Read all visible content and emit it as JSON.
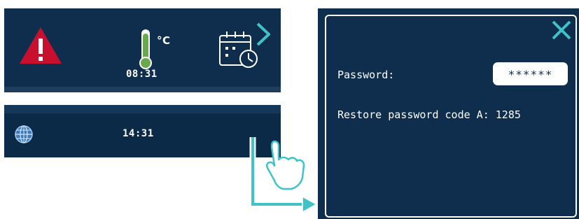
{
  "status_top": {
    "temperature_unit": "°C",
    "time": "08:31",
    "icons": {
      "alarm": "warning-triangle-icon",
      "thermometer": "thermometer-icon",
      "calendar": "calendar-clock-icon"
    },
    "colors": {
      "background": "#0f2d4d",
      "alarm": "#c8102e",
      "thermometer": "#6aa84f"
    }
  },
  "status_bottom": {
    "time": "14:31",
    "icons": {
      "globe": "globe-icon",
      "next": "chevron-right-icon"
    }
  },
  "dialog": {
    "password_label": "Password:",
    "password_value": "******",
    "restore_text": "Restore password code A: 1285",
    "icons": {
      "close": "close-icon"
    },
    "colors": {
      "background": "#0f2d4d",
      "accent": "#3fc3c9"
    }
  },
  "annotation": {
    "icons": {
      "hand": "tap-hand-icon",
      "arrow": "arrow-icon"
    },
    "colors": {
      "line": "#3fc3c9"
    }
  }
}
